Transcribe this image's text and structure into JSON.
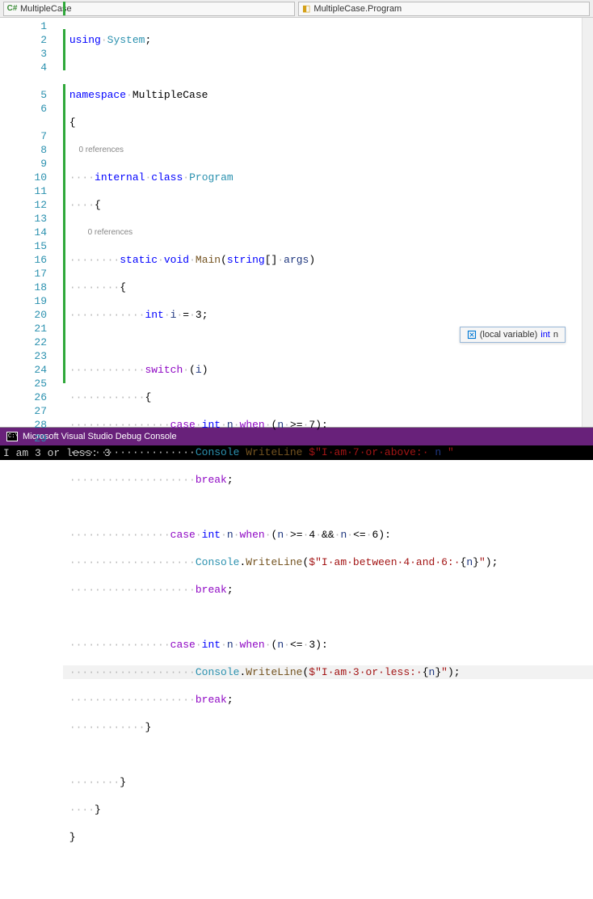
{
  "dropdowns": {
    "left": "MultipleCase",
    "right": "MultipleCase.Program"
  },
  "codelens": {
    "class": "0 references",
    "method": "0 references"
  },
  "tooltip": {
    "prefix": "(local variable)",
    "type": "int",
    "name": "n"
  },
  "console": {
    "title": "Microsoft Visual Studio Debug Console",
    "output": "I am 3 or less: 3"
  },
  "code": {
    "using": "using",
    "system": "System",
    "namespace": "namespace",
    "ns_name": "MultipleCase",
    "internal": "internal",
    "class": "class",
    "program": "Program",
    "static": "static",
    "void": "void",
    "main": "Main",
    "string": "string",
    "args": "args",
    "int": "int",
    "i": "i",
    "eq3": "3",
    "switch": "switch",
    "case": "case",
    "n": "n",
    "when": "when",
    "ge7": "7",
    "console_cls": "Console",
    "writeline": "WriteLine",
    "str7": "\"I·am·7·or·above:·",
    "break": "break",
    "ge4": "4",
    "amp": "&&",
    "le6": "6",
    "str46": "\"I·am·between·4·and·6:·",
    "le3": "3",
    "str3": "\"I·am·3·or·less:·",
    "closeinterp": "\""
  },
  "lines": [
    "1",
    "2",
    "3",
    "4",
    "5",
    "6",
    "7",
    "8",
    "9",
    "10",
    "11",
    "12",
    "13",
    "14",
    "15",
    "16",
    "17",
    "18",
    "19",
    "20",
    "21",
    "22",
    "23",
    "24",
    "25",
    "26",
    "27",
    "28",
    "29"
  ]
}
